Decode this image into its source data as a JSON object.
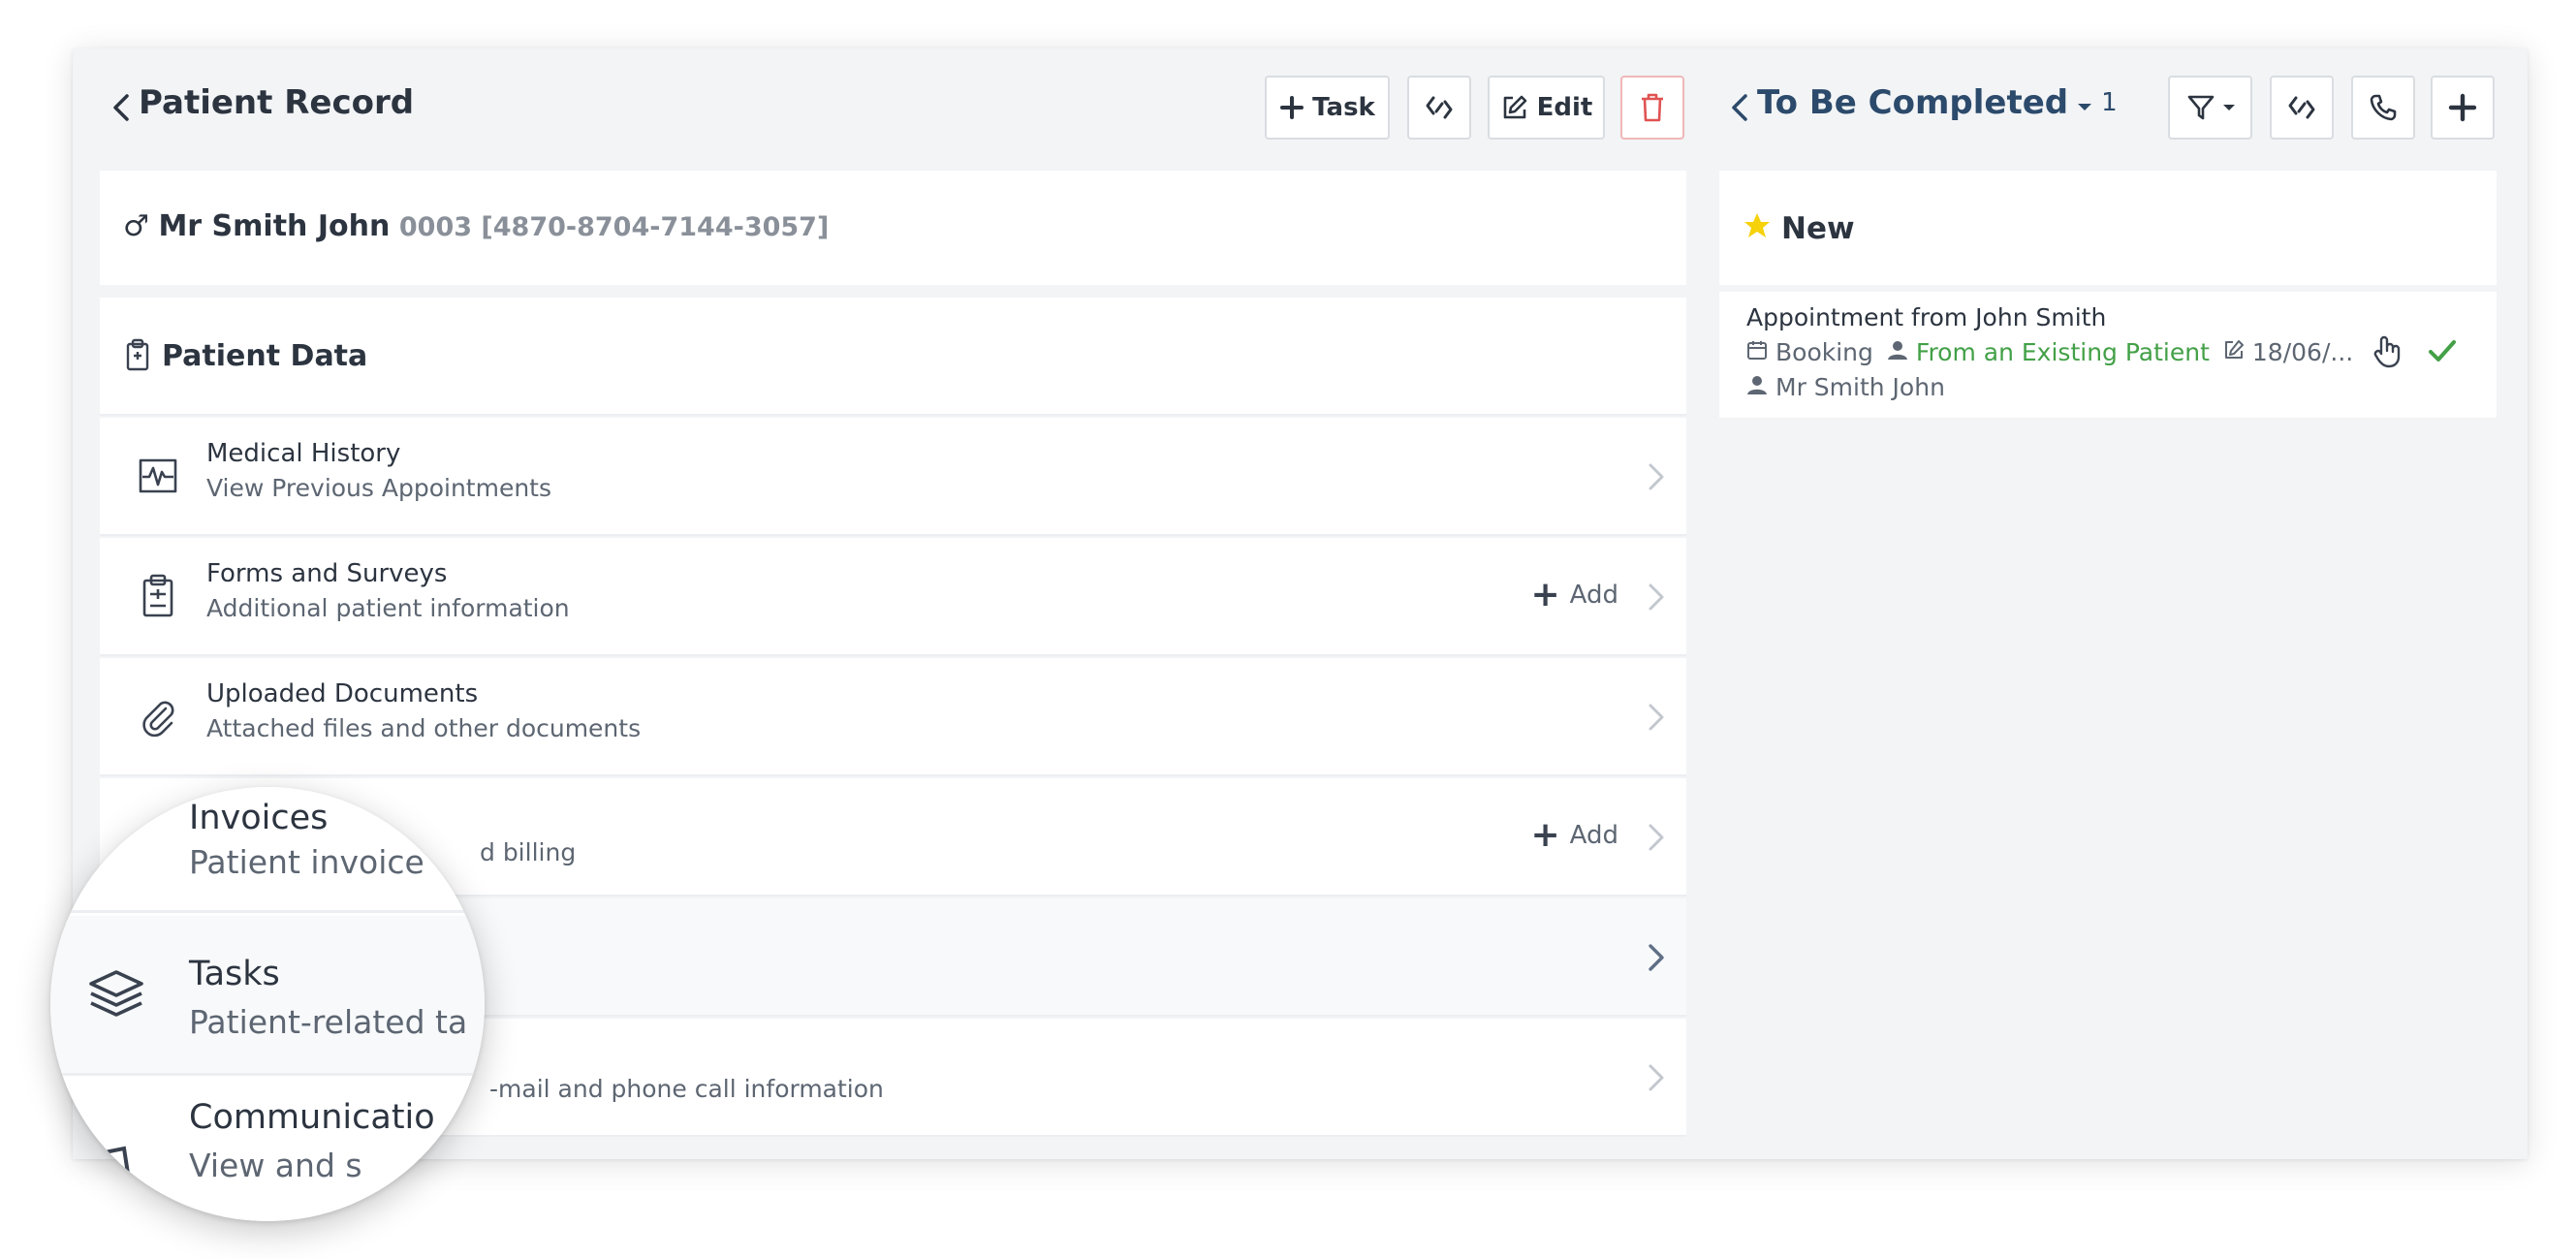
{
  "left_panel": {
    "title": "Patient Record",
    "buttons": {
      "task": "Task",
      "edit": "Edit"
    },
    "patient": {
      "gender_symbol": "♂",
      "name": "Mr Smith John",
      "id": "0003 [4870-8704-7144-3057]"
    },
    "section_title": "Patient Data",
    "items": [
      {
        "title": "Medical History",
        "subtitle": "View Previous Appointments"
      },
      {
        "title": "Forms and Surveys",
        "subtitle": "Additional patient information",
        "action": "Add"
      },
      {
        "title": "Uploaded Documents",
        "subtitle": "Attached files and other documents"
      },
      {
        "title": "Invoices",
        "subtitle": "Patient invoiced billing",
        "action": "Add"
      },
      {
        "title": "Tasks",
        "subtitle": "Patient-related tasks"
      },
      {
        "title": "Communication",
        "subtitle": "View and send e-mail and phone call information"
      }
    ],
    "partial_text": {
      "invoices_tail": "d billing",
      "communication_tail": "-mail and phone call information"
    }
  },
  "right_panel": {
    "title": "To Be Completed",
    "count": "1",
    "group": "New",
    "task": {
      "title": "Appointment from John Smith",
      "type": "Booking",
      "source": "From an Existing Patient",
      "date": "18/06/...",
      "patient": "Mr Smith John"
    }
  },
  "magnifier": {
    "invoices_title": "Invoices",
    "invoices_sub": "Patient invoice",
    "tasks_title": "Tasks",
    "tasks_sub": "Patient-related ta",
    "comm_title": "Communicatio",
    "comm_sub": "View and s"
  },
  "colors": {
    "accent_text": "#2c3440",
    "success": "#43a047",
    "danger": "#e05252",
    "star": "#f5d20a",
    "panel_bg": "#f2f4f6"
  }
}
